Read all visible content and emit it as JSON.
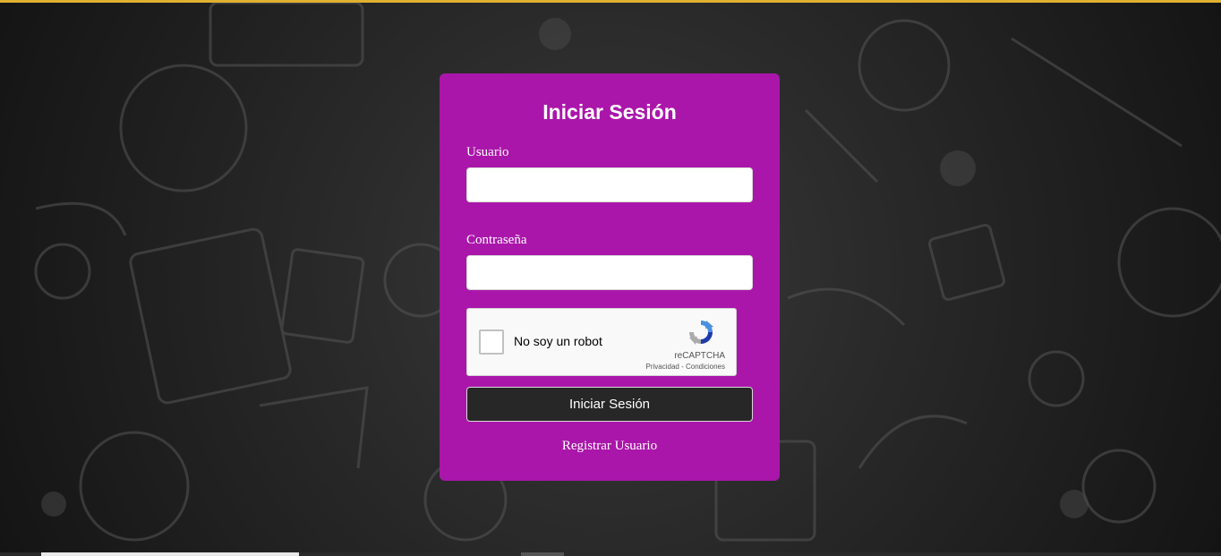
{
  "login": {
    "title": "Iniciar Sesión",
    "username_label": "Usuario",
    "username_value": "",
    "password_label": "Contraseña",
    "password_value": "",
    "submit_label": "Iniciar Sesión",
    "register_label": "Registrar Usuario"
  },
  "recaptcha": {
    "label": "No soy un robot",
    "brand": "reCAPTCHA",
    "privacy_label": "Privacidad",
    "separator": " - ",
    "terms_label": "Condiciones",
    "checked": false
  },
  "theme": {
    "card_color": "#aa16aa",
    "button_color": "#272727",
    "top_strip_color": "#e0b030"
  }
}
